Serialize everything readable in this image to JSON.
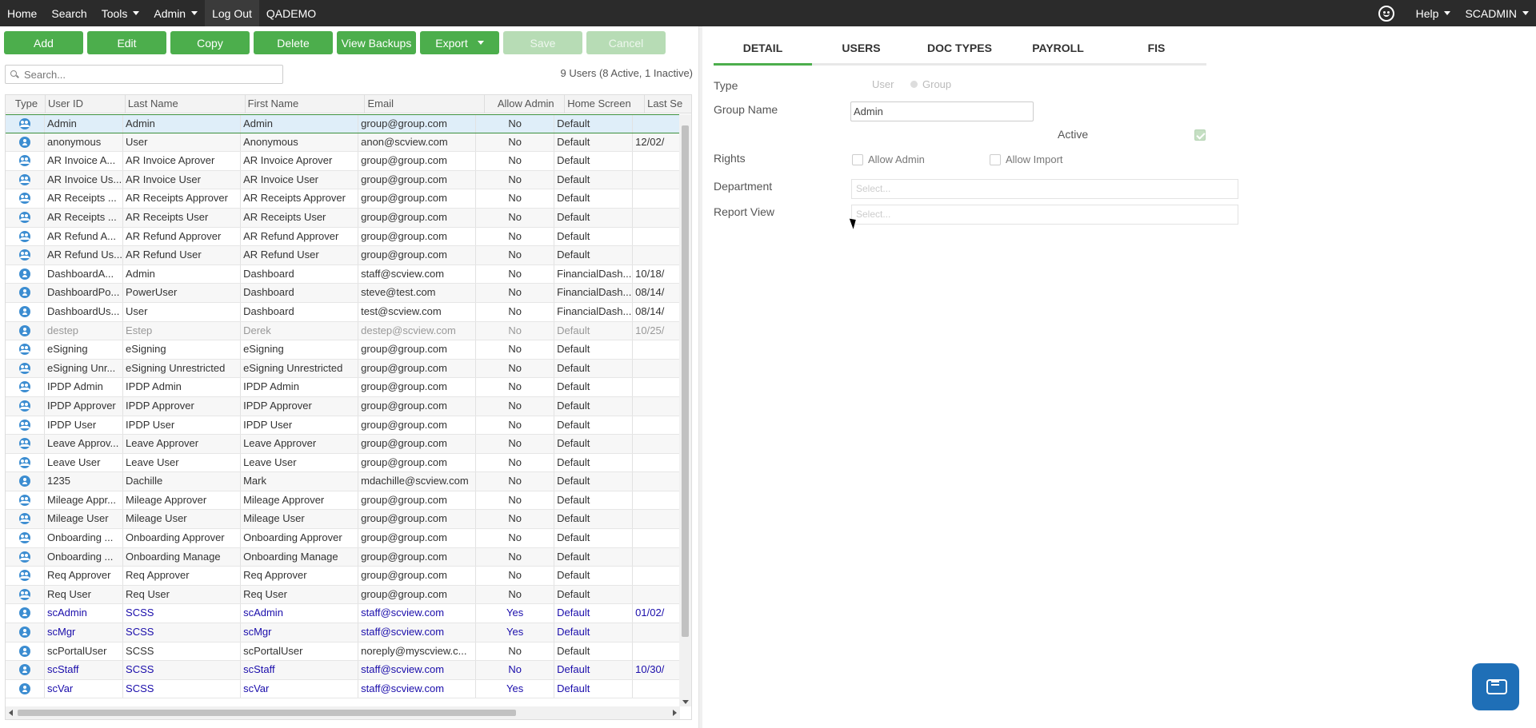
{
  "nav": {
    "items": [
      "Home",
      "Search",
      "Tools",
      "Admin",
      "Log Out",
      "QADEMO"
    ],
    "help": "Help",
    "user": "SCADMIN"
  },
  "toolbar": {
    "add": "Add",
    "edit": "Edit",
    "copy": "Copy",
    "delete": "Delete",
    "view_backups": "View Backups",
    "export": "Export",
    "save": "Save",
    "cancel": "Cancel"
  },
  "search": {
    "placeholder": "Search..."
  },
  "count_text": "9 Users (8 Active, 1 Inactive)",
  "grid": {
    "columns": [
      "Type",
      "User ID",
      "Last Name",
      "First Name",
      "Email",
      "Allow Admin",
      "Home Screen",
      "Last Se"
    ],
    "rows": [
      {
        "type": "group",
        "id": "Admin",
        "last": "Admin",
        "first": "Admin",
        "email": "group@group.com",
        "admin": "No",
        "home": "Default",
        "lastseen": ""
      },
      {
        "type": "user",
        "id": "anonymous",
        "last": "User",
        "first": "Anonymous",
        "email": "anon@scview.com",
        "admin": "No",
        "home": "Default",
        "lastseen": "12/02/"
      },
      {
        "type": "group",
        "id": "AR Invoice A...",
        "last": "AR Invoice Aprover",
        "first": "AR Invoice Aprover",
        "email": "group@group.com",
        "admin": "No",
        "home": "Default",
        "lastseen": ""
      },
      {
        "type": "group",
        "id": "AR Invoice Us...",
        "last": "AR Invoice User",
        "first": "AR Invoice User",
        "email": "group@group.com",
        "admin": "No",
        "home": "Default",
        "lastseen": ""
      },
      {
        "type": "group",
        "id": "AR Receipts ...",
        "last": "AR Receipts Approver",
        "first": "AR Receipts Approver",
        "email": "group@group.com",
        "admin": "No",
        "home": "Default",
        "lastseen": ""
      },
      {
        "type": "group",
        "id": "AR Receipts ...",
        "last": "AR Receipts User",
        "first": "AR Receipts User",
        "email": "group@group.com",
        "admin": "No",
        "home": "Default",
        "lastseen": ""
      },
      {
        "type": "group",
        "id": "AR Refund A...",
        "last": "AR Refund Approver",
        "first": "AR Refund Approver",
        "email": "group@group.com",
        "admin": "No",
        "home": "Default",
        "lastseen": ""
      },
      {
        "type": "group",
        "id": "AR Refund Us...",
        "last": "AR Refund User",
        "first": "AR Refund User",
        "email": "group@group.com",
        "admin": "No",
        "home": "Default",
        "lastseen": ""
      },
      {
        "type": "user",
        "id": "DashboardA...",
        "last": "Admin",
        "first": "Dashboard",
        "email": "staff@scview.com",
        "admin": "No",
        "home": "FinancialDash...",
        "lastseen": "10/18/"
      },
      {
        "type": "user",
        "id": "DashboardPo...",
        "last": "PowerUser",
        "first": "Dashboard",
        "email": "steve@test.com",
        "admin": "No",
        "home": "FinancialDash...",
        "lastseen": "08/14/"
      },
      {
        "type": "user",
        "id": "DashboardUs...",
        "last": "User",
        "first": "Dashboard",
        "email": "test@scview.com",
        "admin": "No",
        "home": "FinancialDash...",
        "lastseen": "08/14/"
      },
      {
        "type": "user",
        "id": "destep",
        "last": "Estep",
        "first": "Derek",
        "email": "destep@scview.com",
        "admin": "No",
        "home": "Default",
        "lastseen": "10/25/",
        "state": "inactive"
      },
      {
        "type": "group",
        "id": "eSigning",
        "last": "eSigning",
        "first": "eSigning",
        "email": "group@group.com",
        "admin": "No",
        "home": "Default",
        "lastseen": ""
      },
      {
        "type": "group",
        "id": "eSigning Unr...",
        "last": "eSigning Unrestricted",
        "first": "eSigning Unrestricted",
        "email": "group@group.com",
        "admin": "No",
        "home": "Default",
        "lastseen": ""
      },
      {
        "type": "group",
        "id": "IPDP Admin",
        "last": "IPDP Admin",
        "first": "IPDP Admin",
        "email": "group@group.com",
        "admin": "No",
        "home": "Default",
        "lastseen": ""
      },
      {
        "type": "group",
        "id": "IPDP Approver",
        "last": "IPDP Approver",
        "first": "IPDP Approver",
        "email": "group@group.com",
        "admin": "No",
        "home": "Default",
        "lastseen": ""
      },
      {
        "type": "group",
        "id": "IPDP User",
        "last": "IPDP User",
        "first": "IPDP User",
        "email": "group@group.com",
        "admin": "No",
        "home": "Default",
        "lastseen": ""
      },
      {
        "type": "group",
        "id": "Leave Approv...",
        "last": "Leave Approver",
        "first": "Leave Approver",
        "email": "group@group.com",
        "admin": "No",
        "home": "Default",
        "lastseen": ""
      },
      {
        "type": "group",
        "id": "Leave User",
        "last": "Leave User",
        "first": "Leave User",
        "email": "group@group.com",
        "admin": "No",
        "home": "Default",
        "lastseen": ""
      },
      {
        "type": "user",
        "id": "1235",
        "last": "Dachille",
        "first": "Mark",
        "email": "mdachille@scview.com",
        "admin": "No",
        "home": "Default",
        "lastseen": ""
      },
      {
        "type": "group",
        "id": "Mileage Appr...",
        "last": "Mileage Approver",
        "first": "Mileage Approver",
        "email": "group@group.com",
        "admin": "No",
        "home": "Default",
        "lastseen": ""
      },
      {
        "type": "group",
        "id": "Mileage User",
        "last": "Mileage User",
        "first": "Mileage User",
        "email": "group@group.com",
        "admin": "No",
        "home": "Default",
        "lastseen": ""
      },
      {
        "type": "group",
        "id": "Onboarding ...",
        "last": "Onboarding Approver",
        "first": "Onboarding Approver",
        "email": "group@group.com",
        "admin": "No",
        "home": "Default",
        "lastseen": ""
      },
      {
        "type": "group",
        "id": "Onboarding ...",
        "last": "Onboarding Manage",
        "first": "Onboarding Manage",
        "email": "group@group.com",
        "admin": "No",
        "home": "Default",
        "lastseen": ""
      },
      {
        "type": "group",
        "id": "Req Approver",
        "last": "Req Approver",
        "first": "Req Approver",
        "email": "group@group.com",
        "admin": "No",
        "home": "Default",
        "lastseen": ""
      },
      {
        "type": "group",
        "id": "Req User",
        "last": "Req User",
        "first": "Req User",
        "email": "group@group.com",
        "admin": "No",
        "home": "Default",
        "lastseen": ""
      },
      {
        "type": "user",
        "id": "scAdmin",
        "last": "SCSS",
        "first": "scAdmin",
        "email": "staff@scview.com",
        "admin": "Yes",
        "home": "Default",
        "lastseen": "01/02/",
        "state": "admin"
      },
      {
        "type": "user",
        "id": "scMgr",
        "last": "SCSS",
        "first": "scMgr",
        "email": "staff@scview.com",
        "admin": "Yes",
        "home": "Default",
        "lastseen": "",
        "state": "admin"
      },
      {
        "type": "user",
        "id": "scPortalUser",
        "last": "SCSS",
        "first": "scPortalUser",
        "email": "noreply@myscview.c...",
        "admin": "No",
        "home": "Default",
        "lastseen": ""
      },
      {
        "type": "user",
        "id": "scStaff",
        "last": "SCSS",
        "first": "scStaff",
        "email": "staff@scview.com",
        "admin": "No",
        "home": "Default",
        "lastseen": "10/30/",
        "state": "admin"
      },
      {
        "type": "user",
        "id": "scVar",
        "last": "SCSS",
        "first": "scVar",
        "email": "staff@scview.com",
        "admin": "Yes",
        "home": "Default",
        "lastseen": "",
        "state": "admin"
      }
    ]
  },
  "detail": {
    "tabs": [
      "DETAIL",
      "USERS",
      "DOC TYPES",
      "PAYROLL",
      "FIS"
    ],
    "type_label": "Type",
    "type_user": "User",
    "type_group": "Group",
    "group_name_label": "Group Name",
    "group_name_value": "Admin",
    "active_label": "Active",
    "rights_label": "Rights",
    "allow_admin": "Allow Admin",
    "allow_import": "Allow Import",
    "department_label": "Department",
    "department_placeholder": "Select...",
    "report_view_label": "Report View",
    "report_view_placeholder": "Select..."
  },
  "colors": {
    "accent": "#4cae4c",
    "nav": "#2b2b2b",
    "link": "#1a0dab",
    "chat": "#1f6fb7"
  }
}
